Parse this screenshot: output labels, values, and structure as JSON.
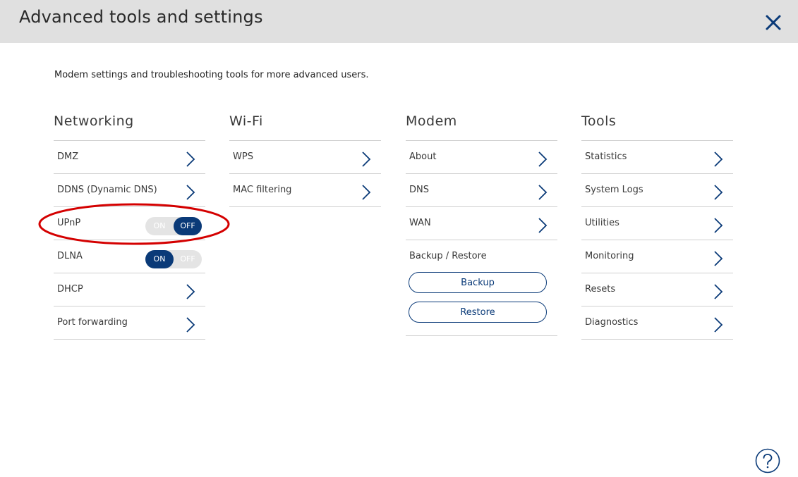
{
  "header": {
    "title": "Advanced tools and settings"
  },
  "intro": "Modem settings and troubleshooting tools for more advanced users.",
  "networking": {
    "title": "Networking",
    "items": [
      {
        "label": "DMZ"
      },
      {
        "label": "DDNS (Dynamic DNS)"
      },
      {
        "label": "UPnP",
        "toggle": {
          "on_label": "ON",
          "off_label": "OFF",
          "state": "off"
        }
      },
      {
        "label": "DLNA",
        "toggle": {
          "on_label": "ON",
          "off_label": "OFF",
          "state": "on"
        }
      },
      {
        "label": "DHCP"
      },
      {
        "label": "Port forwarding"
      }
    ]
  },
  "wifi": {
    "title": "Wi-Fi",
    "items": [
      {
        "label": "WPS"
      },
      {
        "label": "MAC filtering"
      }
    ]
  },
  "modem": {
    "title": "Modem",
    "items": [
      {
        "label": "About"
      },
      {
        "label": "DNS"
      },
      {
        "label": "WAN"
      }
    ],
    "backup_restore": {
      "label": "Backup / Restore",
      "backup_button": "Backup",
      "restore_button": "Restore"
    }
  },
  "tools": {
    "title": "Tools",
    "items": [
      {
        "label": "Statistics"
      },
      {
        "label": "System Logs"
      },
      {
        "label": "Utilities"
      },
      {
        "label": "Monitoring"
      },
      {
        "label": "Resets"
      },
      {
        "label": "Diagnostics"
      }
    ]
  },
  "icons": {
    "close": "close-icon",
    "chevron": "chevron-right-icon",
    "help": "help-icon"
  },
  "colors": {
    "accent": "#0a3a78",
    "header_bg": "#e0e0e0",
    "annotation": "#d40000"
  }
}
